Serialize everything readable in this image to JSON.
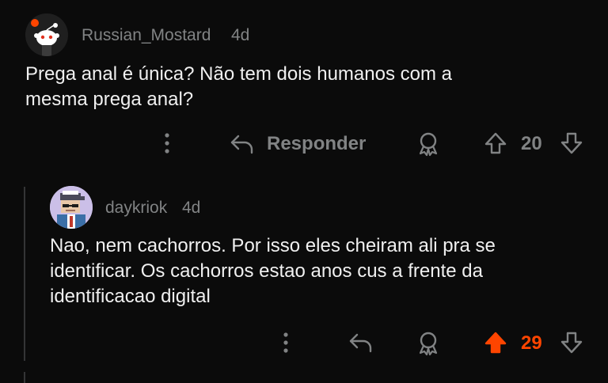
{
  "parent": {
    "username": "Russian_Mostard",
    "age": "4d",
    "text_line1": "Prega anal é única? Não tem dois humanos com a",
    "text_line2": "mesma prega anal?",
    "reply_label": "Responder",
    "score": "20",
    "avatar_icon": "reddit-snoo-avatar"
  },
  "reply": {
    "username": "daykriok",
    "age": "4d",
    "text_line1": "Nao, nem cachorros. Por isso eles cheiram ali pra se",
    "text_line2": "identificar. Os cachorros estao anos cus a frente da",
    "text_line3": "identificacao digital",
    "score": "29",
    "avatar_icon": "pixel-art-avatar",
    "upvoted": true
  },
  "colors": {
    "background": "#0b0b0b",
    "text": "#f0f0f0",
    "muted": "#818384",
    "upvote_active": "#ff4500"
  }
}
